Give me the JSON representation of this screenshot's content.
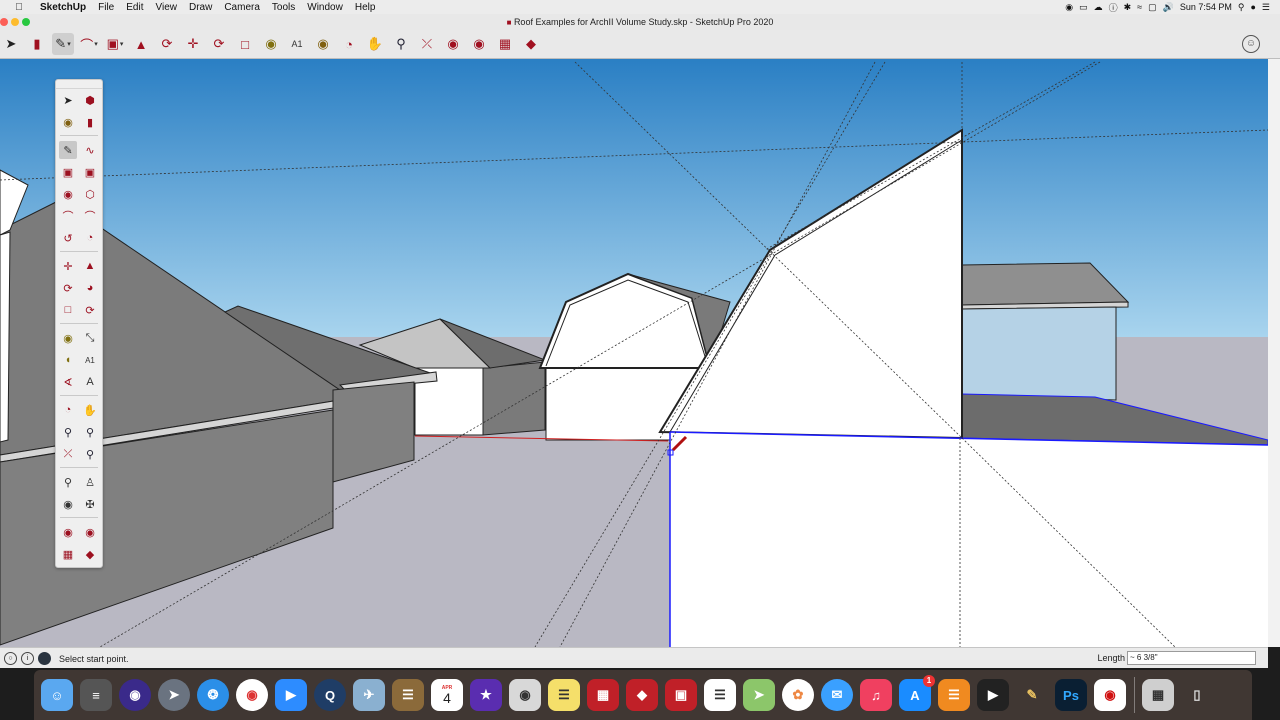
{
  "menubar": {
    "apple": "",
    "app_name": "SketchUp",
    "items": [
      "File",
      "Edit",
      "View",
      "Draw",
      "Camera",
      "Tools",
      "Window",
      "Help"
    ],
    "clock": "Sun 7:54 PM"
  },
  "window": {
    "title": "Roof Examples for ArchII Volume Study.skp - SketchUp Pro 2020"
  },
  "toolbar": {
    "tools": [
      "select-icon",
      "eraser-icon",
      "pencil-icon",
      "arc-icon",
      "rectangle-icon",
      "push-pull-icon",
      "offset-icon",
      "move-icon",
      "rotate-icon",
      "scale-icon",
      "tape-measure-icon",
      "text-icon",
      "paint-bucket-icon",
      "orbit-icon",
      "pan-icon",
      "zoom-icon",
      "zoom-extents-icon",
      "warehouse-icon",
      "extension-warehouse-icon",
      "layout-icon",
      "ruby-icon"
    ]
  },
  "statusbar": {
    "message": "Select start point.",
    "measure_label": "Length",
    "measure_value": "~ 6 3/8\""
  },
  "dock": {
    "badges": {
      "app_store": "1",
      "calendar_day": "4",
      "calendar_month": "APR"
    }
  },
  "colors": {
    "sky_top": "#2a7fc4",
    "sky_horizon": "#a8d4ee",
    "ground": "#b9b8c3",
    "accent_red": "#a01020"
  }
}
